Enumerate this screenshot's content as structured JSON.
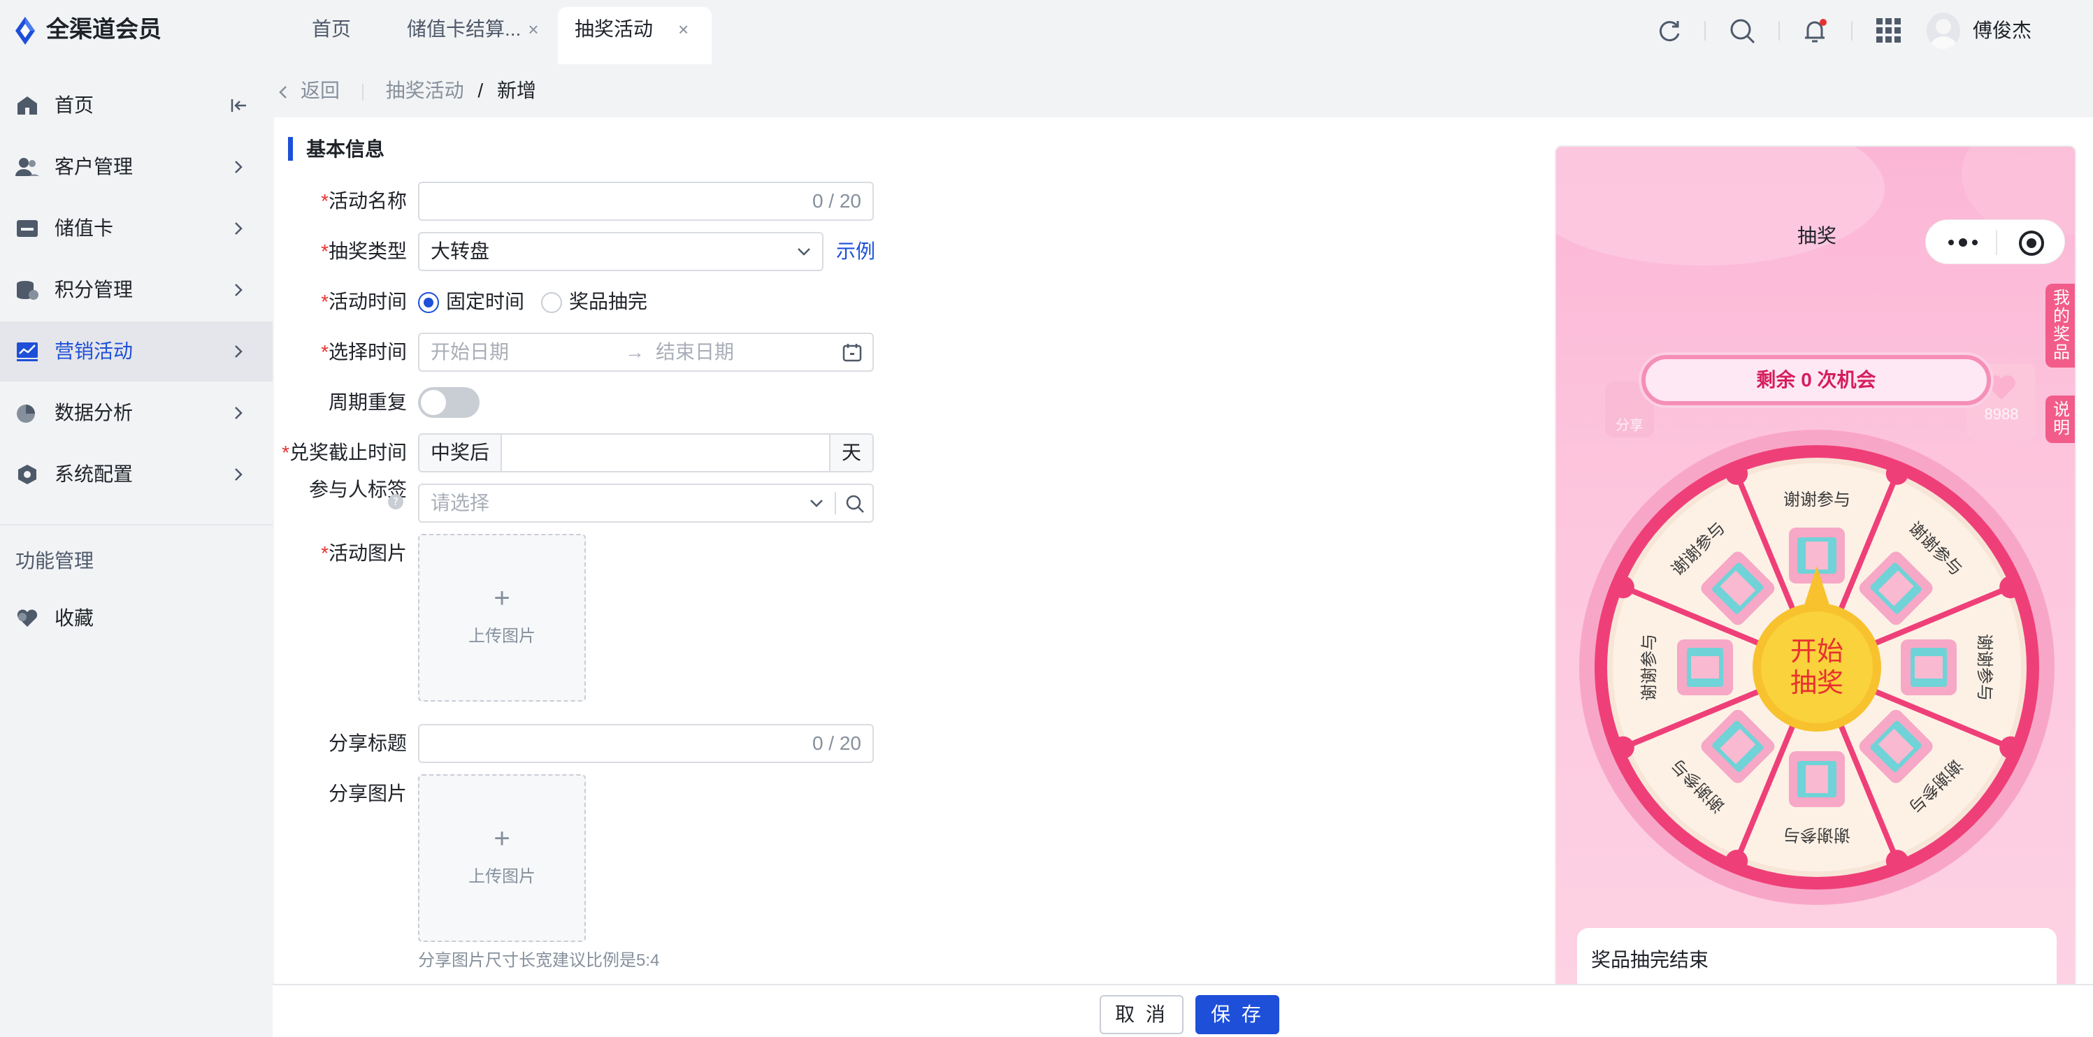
{
  "app": {
    "brand": "全渠道会员"
  },
  "tabs": [
    {
      "label": "首页",
      "closable": false
    },
    {
      "label": "储值卡结算...",
      "closable": true
    },
    {
      "label": "抽奖活动",
      "closable": true,
      "active": true
    }
  ],
  "tab_close_glyph": "×",
  "header": {
    "icons": [
      "refresh-icon",
      "search-icon",
      "bell-icon",
      "apps-grid-icon"
    ],
    "notification_dot_color": "#e8312f",
    "user_name": "傅俊杰"
  },
  "sidebar": {
    "items": [
      {
        "label": "首页",
        "icon": "home-icon",
        "collapse_icon": true
      },
      {
        "label": "客户管理",
        "icon": "users-icon"
      },
      {
        "label": "储值卡",
        "icon": "card-icon"
      },
      {
        "label": "积分管理",
        "icon": "coins-icon"
      },
      {
        "label": "营销活动",
        "icon": "chart-icon",
        "active": true
      },
      {
        "label": "数据分析",
        "icon": "pie-chart-icon"
      },
      {
        "label": "系统配置",
        "icon": "settings-icon"
      }
    ],
    "section_label": "功能管理",
    "favorites_label": "收藏"
  },
  "breadcrumb": {
    "back": "返回",
    "parent": "抽奖活动",
    "separator": "/",
    "current": "新增"
  },
  "form": {
    "section_title": "基本信息",
    "required_mark": "*",
    "name": {
      "label": "活动名称",
      "value": "",
      "counter": "0 / 20"
    },
    "lottery_type": {
      "label": "抽奖类型",
      "value": "大转盘",
      "example_link": "示例"
    },
    "activity_time": {
      "label": "活动时间",
      "options": [
        "固定时间",
        "奖品抽完"
      ],
      "selected": "固定时间"
    },
    "select_time": {
      "label": "选择时间",
      "start_placeholder": "开始日期",
      "arrow": "→",
      "end_placeholder": "结束日期"
    },
    "repeat": {
      "label": "周期重复",
      "enabled": false
    },
    "redeem_deadline": {
      "label": "兑奖截止时间",
      "prefix": "中奖后",
      "value": "",
      "suffix": "天"
    },
    "participant_tags": {
      "label": "参与人标签",
      "placeholder": "请选择"
    },
    "activity_image": {
      "label": "活动图片",
      "upload_text": "上传图片",
      "plus": "+"
    },
    "share_title": {
      "label": "分享标题",
      "value": "",
      "counter": "0 / 20"
    },
    "share_image": {
      "label": "分享图片",
      "upload_text": "上传图片",
      "plus": "+",
      "hint": "分享图片尺寸长宽建议比例是5:4"
    }
  },
  "footer": {
    "cancel": "取 消",
    "save": "保 存"
  },
  "accent_color": "#1d4fd8",
  "preview": {
    "title": "抽奖",
    "my_prizes": "我的奖品",
    "instructions": "说明",
    "share_badge": "分享",
    "likes": "8988",
    "chances": "剩余 0 次机会",
    "start_button": [
      "开始",
      "抽奖"
    ],
    "segments": [
      "谢谢参与",
      "谢谢参与",
      "谢谢参与",
      "谢谢参与",
      "谢谢参与",
      "谢谢参与",
      "谢谢参与",
      "谢谢参与"
    ],
    "result": "奖品抽完结束"
  }
}
